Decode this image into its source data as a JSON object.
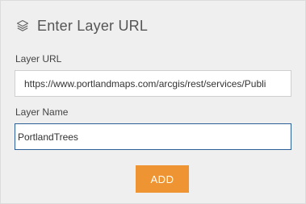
{
  "header": {
    "icon": "layers-icon",
    "title": "Enter Layer URL"
  },
  "form": {
    "url_label": "Layer URL",
    "url_value": "https://www.portlandmaps.com/arcgis/rest/services/Publi",
    "name_label": "Layer Name",
    "name_value": "PortlandTrees",
    "add_label": "ADD"
  },
  "colors": {
    "panel_bg": "#efefef",
    "accent": "#ee9432",
    "focus_border": "#2b5f96"
  }
}
